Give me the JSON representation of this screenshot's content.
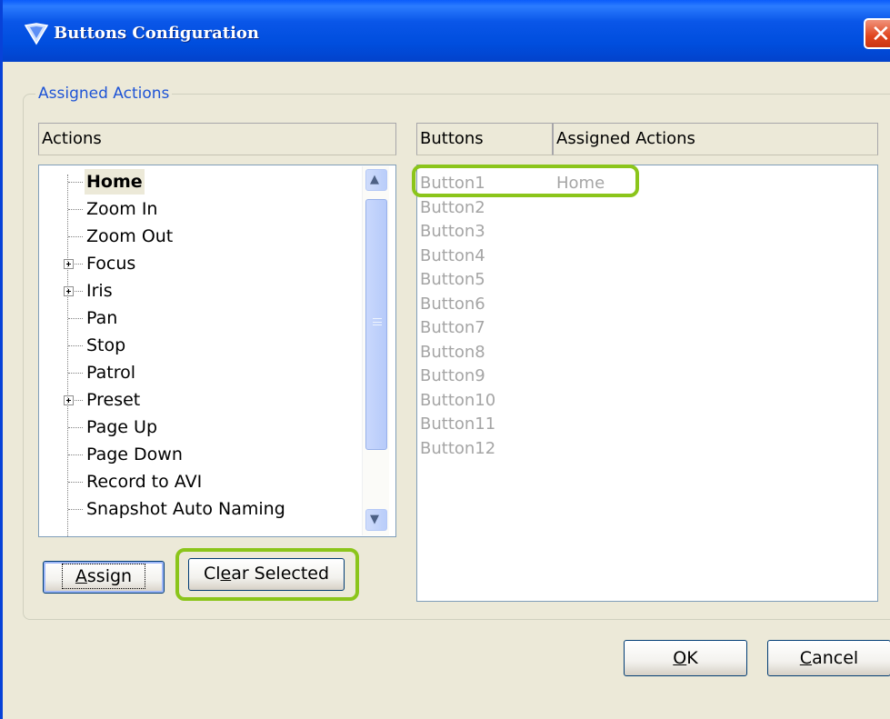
{
  "window": {
    "title": "Buttons Configuration",
    "close_glyph": "✕",
    "title_color": "#0a56e8"
  },
  "group": {
    "legend": "Assigned Actions"
  },
  "actions": {
    "header": "Actions",
    "items": [
      {
        "label": "Home",
        "expandable": false,
        "selected": true
      },
      {
        "label": "Zoom In",
        "expandable": false
      },
      {
        "label": "Zoom Out",
        "expandable": false
      },
      {
        "label": "Focus",
        "expandable": true
      },
      {
        "label": "Iris",
        "expandable": true
      },
      {
        "label": "Pan",
        "expandable": false
      },
      {
        "label": "Stop",
        "expandable": false
      },
      {
        "label": "Patrol",
        "expandable": false
      },
      {
        "label": "Preset",
        "expandable": true
      },
      {
        "label": "Page Up",
        "expandable": false
      },
      {
        "label": "Page Down",
        "expandable": false
      },
      {
        "label": "Record to AVI",
        "expandable": false
      },
      {
        "label": "Snapshot Auto Naming",
        "expandable": false
      }
    ]
  },
  "buttons_table": {
    "headers": [
      "Buttons",
      "Assigned Actions"
    ],
    "rows": [
      {
        "button": "Button1",
        "action": "Home"
      },
      {
        "button": "Button2",
        "action": ""
      },
      {
        "button": "Button3",
        "action": ""
      },
      {
        "button": "Button4",
        "action": ""
      },
      {
        "button": "Button5",
        "action": ""
      },
      {
        "button": "Button6",
        "action": ""
      },
      {
        "button": "Button7",
        "action": ""
      },
      {
        "button": "Button8",
        "action": ""
      },
      {
        "button": "Button9",
        "action": ""
      },
      {
        "button": "Button10",
        "action": ""
      },
      {
        "button": "Button11",
        "action": ""
      },
      {
        "button": "Button12",
        "action": ""
      }
    ]
  },
  "controls": {
    "assign": "Assign",
    "clear_selected": "Clear Selected",
    "ok": "OK",
    "cancel": "Cancel"
  },
  "highlight_color": "#8bc51b",
  "icons": {
    "title": "shield-icon",
    "scroll_up": "chevron-up-icon",
    "scroll_down": "chevron-down-icon",
    "expand": "plus-box-icon"
  }
}
